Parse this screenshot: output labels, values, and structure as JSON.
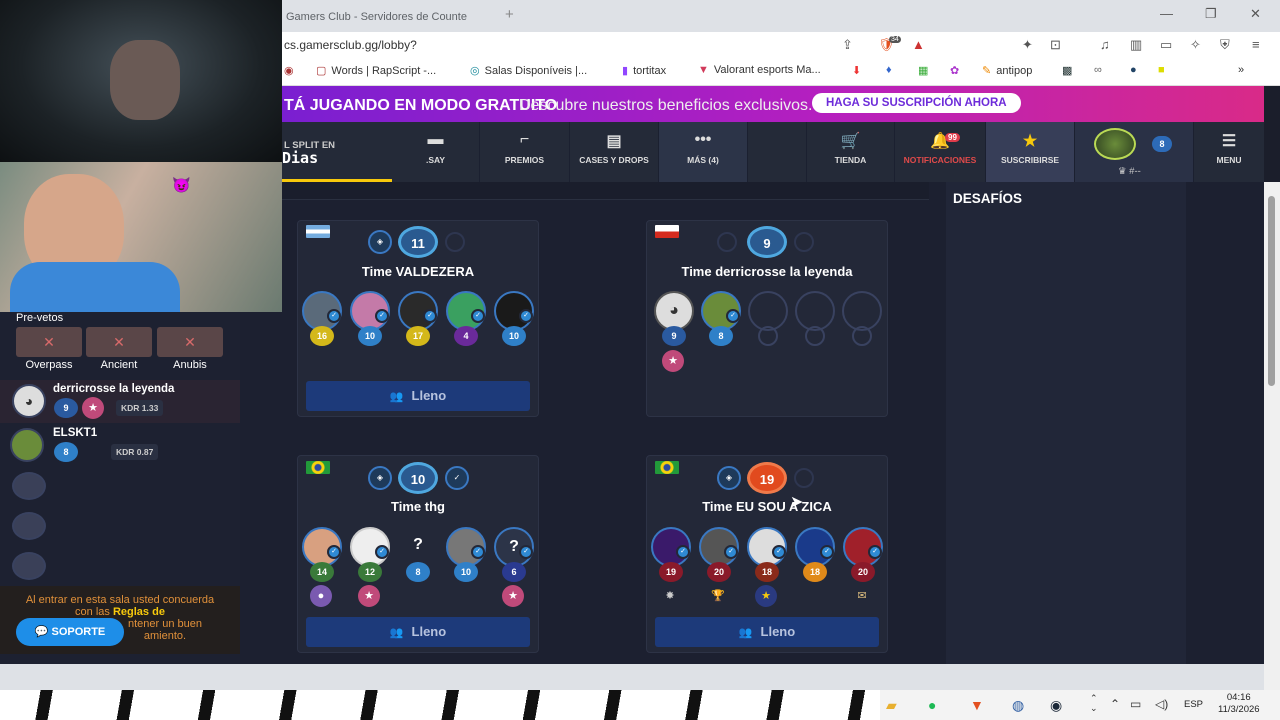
{
  "browser": {
    "tab_title": "Gamers Club - Servidores de Counte",
    "new_tab": "+",
    "url": "cs.gamersclub.gg/lobby?",
    "bookmarks": [
      "Words | RapScript -...",
      "Salas Disponíveis |...",
      "tortitax",
      "Valorant esports Ma...",
      "antipop"
    ],
    "bookmarks_more": "»",
    "ext_badge": "34"
  },
  "promo": {
    "bold_text": "TÁ JUGANDO EN MODO GRATUITO",
    "text": "Descubre nuestros beneficios exclusivos.",
    "button": "HAGA SU SUSCRIPCIÓN AHORA"
  },
  "nav": {
    "split_label": "L SPLIT EN",
    "split_value": "Dias",
    "items": [
      {
        "label": ".SAY",
        "icon": "chat-icon"
      },
      {
        "label": "PREMIOS",
        "icon": "gun-icon"
      },
      {
        "label": "CASES Y DROPS",
        "icon": "chest-icon"
      },
      {
        "label": "MÁS (4)",
        "icon": "dots-icon"
      },
      {
        "label": "TIENDA",
        "icon": "cart-icon"
      },
      {
        "label": "NOTIFICACIONES",
        "icon": "bell-icon"
      },
      {
        "label": "SUSCRIBIRSE",
        "icon": "subscribe-icon"
      },
      {
        "label": "MENU",
        "icon": "menu-icon"
      }
    ],
    "notif_count": "99",
    "profile_level": "8",
    "profile_rank": "#--"
  },
  "sidebar": {
    "title": "DESAFÍOS"
  },
  "lobby": {
    "prevetos_title": "Pre-vetos",
    "maps": [
      "Overpass",
      "Ancient",
      "Anubis"
    ],
    "players": [
      {
        "name": "derricrosse la leyenda",
        "level": "9",
        "kdr": "KDR 1.33"
      },
      {
        "name": "ELSKT1",
        "level": "8",
        "kdr": "KDR 0.87"
      }
    ],
    "notice_1": "Al entrar en esta sala usted concuerda con las ",
    "notice_link": "Reglas de",
    "notice_2": "ntener un buen",
    "notice_3": "amiento.",
    "support_button": "SOPORTE"
  },
  "teams": [
    {
      "name": "Time VALDEZERA",
      "level": "11",
      "players": [
        "16",
        "10",
        "17",
        "4",
        "10"
      ],
      "button": "Lleno"
    },
    {
      "name": "Time derricrosse la leyenda",
      "level": "9",
      "players": [
        "9",
        "8"
      ],
      "button": ""
    },
    {
      "name": "Time thg",
      "level": "10",
      "players": [
        "14",
        "12",
        "8",
        "10",
        "6"
      ],
      "button": "Lleno"
    },
    {
      "name": "Time EU SOU A ZICA",
      "level": "19",
      "players": [
        "19",
        "20",
        "18",
        "18",
        "20"
      ],
      "button": "Lleno"
    }
  ],
  "taskbar": {
    "lang": "ESP",
    "time": "04:16",
    "date": "11/3/2026"
  },
  "colors": {
    "accent_yellow": "#f7c90c",
    "promo_purple": "#7a1fd1",
    "promo_pink": "#d92a88",
    "lleno_button": "#1d3a7a",
    "level_blue": "#2f8ad4",
    "level_red": "#e14a1e"
  }
}
